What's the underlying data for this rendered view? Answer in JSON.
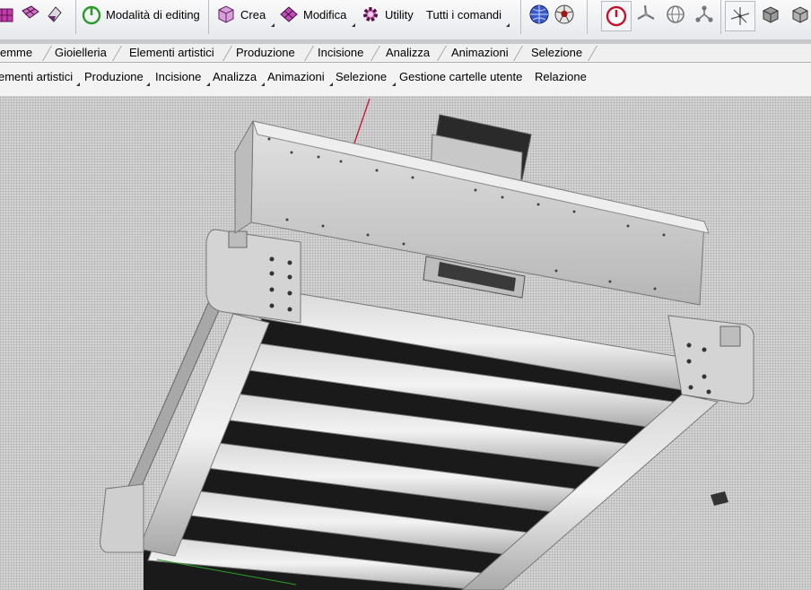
{
  "toolbar": {
    "editing_label": "Modalità di editing",
    "create_label": "Crea",
    "modify_label": "Modifica",
    "utility_label": "Utility",
    "all_commands_label": "Tutti i comandi"
  },
  "tabs": [
    "emme",
    "Gioielleria",
    "Elementi artistici",
    "Produzione",
    "Incisione",
    "Analizza",
    "Animazioni",
    "Selezione"
  ],
  "menu": [
    "ementi artistici",
    "Produzione",
    "Incisione",
    "Analizza",
    "Animazioni",
    "Selezione",
    "Gestione cartelle utente",
    "Relazione"
  ],
  "colors": {
    "accent_red": "#c8102e",
    "viewport_bg": "#d4d4d4",
    "model_gray": "#c4c4c4"
  }
}
